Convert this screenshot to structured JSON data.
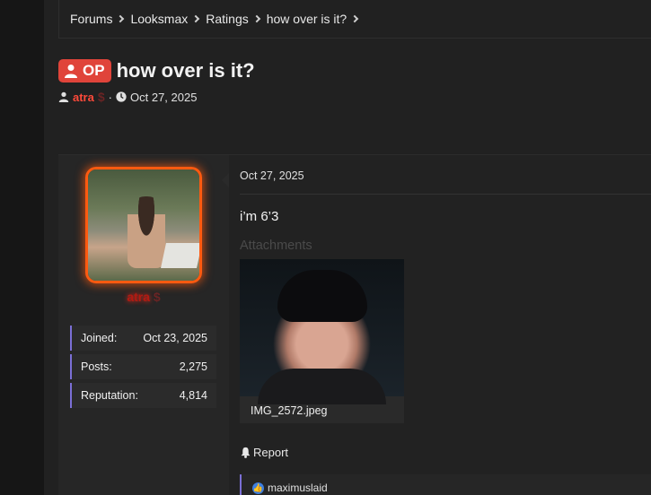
{
  "breadcrumb": [
    "Forums",
    "Looksmax",
    "Ratings",
    "how over is it?"
  ],
  "thread": {
    "op_badge": "OP",
    "title": "how over is it?",
    "author": "atra",
    "author_suffix": "$",
    "date": "Oct 27, 2025"
  },
  "user": {
    "name": "atra",
    "suffix": "$",
    "stats": [
      {
        "label": "Joined:",
        "value": "Oct 23, 2025"
      },
      {
        "label": "Posts:",
        "value": "2,275"
      },
      {
        "label": "Reputation:",
        "value": "4,814"
      }
    ]
  },
  "post": {
    "date": "Oct 27, 2025",
    "text": "i’m 6’3",
    "attachments_label": "Attachments",
    "attachment_name": "IMG_2572.jpeg",
    "report_label": "Report",
    "reaction_user": "maximuslaid"
  },
  "colors": {
    "accent": "#7b6fd6",
    "op_badge": "#e0443a",
    "author": "#ff4a3a",
    "avatar_glow": "#ff5a10"
  }
}
